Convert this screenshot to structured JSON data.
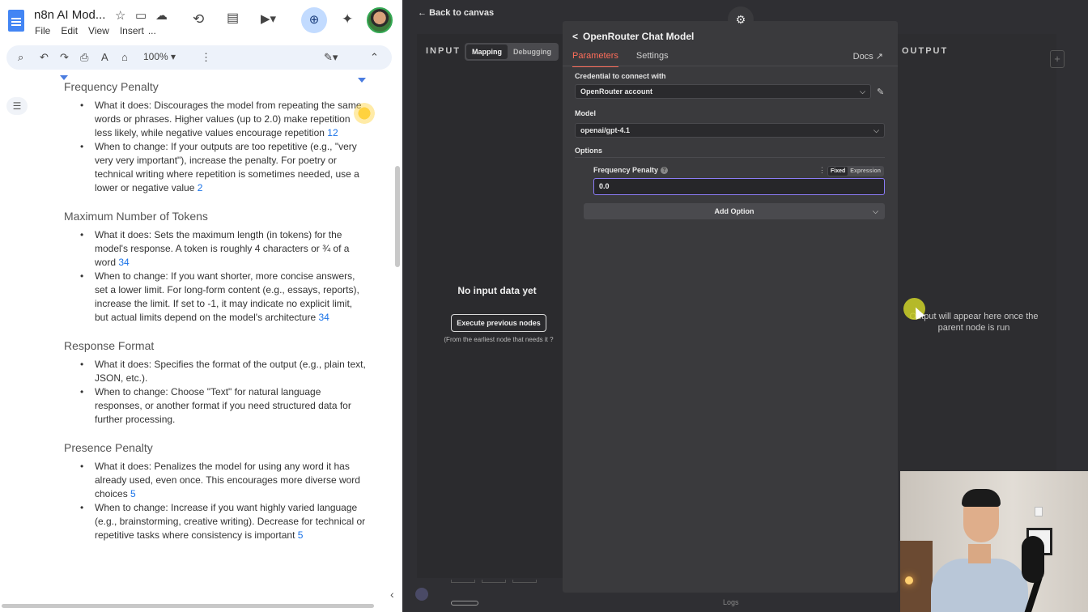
{
  "docs": {
    "title": "n8n AI Mod...",
    "menu": [
      "File",
      "Edit",
      "View",
      "Insert",
      "..."
    ],
    "zoom": "100%",
    "sections": [
      {
        "heading": "Frequency Penalty",
        "bullets": [
          {
            "text": "What it does: Discourages the model from repeating the same words or phrases. Higher values (up to 2.0) make repetition less likely, while negative values encourage repetition ",
            "ref": "12"
          },
          {
            "text": "When to change: If your outputs are too repetitive (e.g., \"very very very important\"), increase the penalty. For poetry or technical writing where repetition is sometimes needed, use a lower or negative value ",
            "ref": "2"
          }
        ]
      },
      {
        "heading": "Maximum Number of Tokens",
        "bullets": [
          {
            "text": "What it does: Sets the maximum length (in tokens) for the model's response. A token is roughly 4 characters or ¾ of a word ",
            "ref": "34"
          },
          {
            "text": "When to change: If you want shorter, more concise answers, set a lower limit. For long-form content (e.g., essays, reports), increase the limit. If set to -1, it may indicate no explicit limit, but actual limits depend on the model's architecture ",
            "ref": "34"
          }
        ]
      },
      {
        "heading": "Response Format",
        "bullets": [
          {
            "text": "What it does: Specifies the format of the output (e.g., plain text, JSON, etc.).",
            "ref": ""
          },
          {
            "text": "When to change: Choose \"Text\" for natural language responses, or another format if you need structured data for further processing.",
            "ref": ""
          }
        ]
      },
      {
        "heading": "Presence Penalty",
        "bullets": [
          {
            "text": "What it does: Penalizes the model for using any word it has already used, even once. This encourages more diverse word choices ",
            "ref": "5"
          },
          {
            "text": "When to change: Increase if you want highly varied language (e.g., brainstorming, creative writing). Decrease for technical or repetitive tasks where consistency is important ",
            "ref": "5"
          }
        ]
      }
    ]
  },
  "n8n": {
    "back_label": "Back to canvas",
    "input": {
      "label": "INPUT",
      "tabs": [
        "Mapping",
        "Debugging"
      ],
      "active_tab": "Mapping",
      "empty_title": "No input data yet",
      "execute_button": "Execute previous nodes",
      "hint": "(From the earliest node that needs it"
    },
    "node": {
      "title": "OpenRouter Chat Model",
      "tabs": [
        "Parameters",
        "Settings"
      ],
      "docs_label": "Docs",
      "credential_label": "Credential to connect with",
      "credential_value": "OpenRouter account",
      "model_label": "Model",
      "model_value": "openai/gpt-4.1",
      "options_label": "Options",
      "frequency_penalty_label": "Frequency Penalty",
      "mode_fixed": "Fixed",
      "mode_expression": "Expression",
      "frequency_penalty_value": "0.0",
      "add_option_label": "Add Option"
    },
    "output": {
      "label": "OUTPUT",
      "message": "Output will appear here once the parent node is run"
    },
    "footer": {
      "logs_label": "Logs"
    }
  },
  "colors": {
    "accent": "#ff6d5a",
    "input_focus": "#8b7cf6",
    "docs_link": "#1a73e8"
  }
}
